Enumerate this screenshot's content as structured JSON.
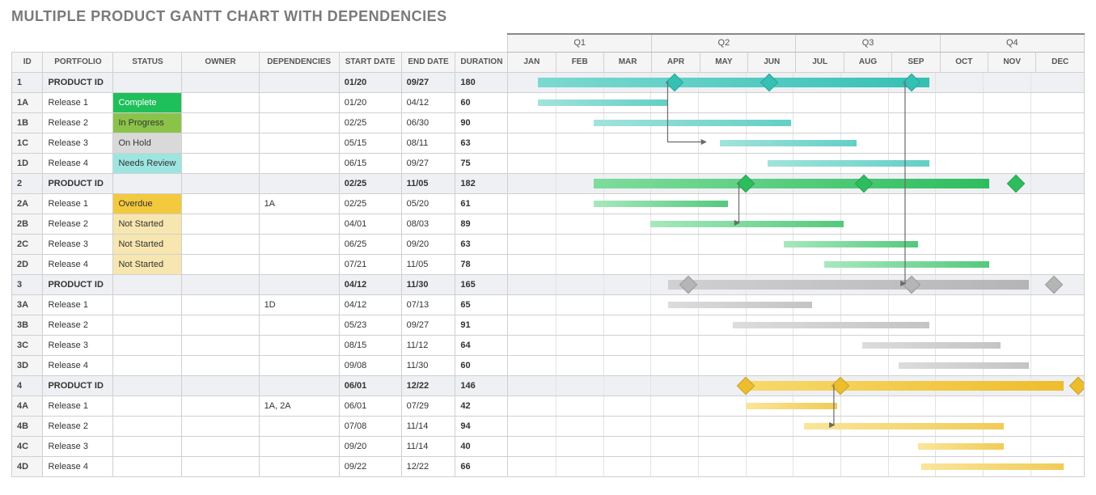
{
  "title": "MULTIPLE PRODUCT GANTT CHART WITH DEPENDENCIES",
  "headers": {
    "id": "ID",
    "portfolio": "PORTFOLIO",
    "status": "STATUS",
    "owner": "OWNER",
    "deps": "DEPENDENCIES",
    "start": "START DATE",
    "end": "END DATE",
    "dur": "DURATION"
  },
  "quarters": [
    "Q1",
    "Q2",
    "Q3",
    "Q4"
  ],
  "months": [
    "JAN",
    "FEB",
    "MAR",
    "APR",
    "MAY",
    "JUN",
    "JUL",
    "AUG",
    "SEP",
    "OCT",
    "NOV",
    "DEC"
  ],
  "status_labels": {
    "complete": "Complete",
    "progress": "In Progress",
    "hold": "On Hold",
    "review": "Needs Review",
    "overdue": "Overdue",
    "notstarted": "Not Started"
  },
  "rows": [
    {
      "id": "1",
      "portfolio": "PRODUCT ID",
      "status": "",
      "owner": "",
      "deps": "",
      "start": "01/20",
      "end": "09/27",
      "dur": "180",
      "product": true,
      "color": "teal",
      "barClass": "teal",
      "lbarClass": "tealL",
      "milestones": [
        3.5,
        5.5,
        8.5
      ]
    },
    {
      "id": "1A",
      "portfolio": "Release 1",
      "status": "complete",
      "owner": "",
      "deps": "",
      "start": "01/20",
      "end": "04/12",
      "dur": "60",
      "color": "teal"
    },
    {
      "id": "1B",
      "portfolio": "Release 2",
      "status": "progress",
      "owner": "",
      "deps": "",
      "start": "02/25",
      "end": "06/30",
      "dur": "90",
      "color": "teal"
    },
    {
      "id": "1C",
      "portfolio": "Release 3",
      "status": "hold",
      "owner": "",
      "deps": "",
      "start": "05/15",
      "end": "08/11",
      "dur": "63",
      "color": "teal"
    },
    {
      "id": "1D",
      "portfolio": "Release 4",
      "status": "review",
      "owner": "",
      "deps": "",
      "start": "06/15",
      "end": "09/27",
      "dur": "75",
      "color": "teal"
    },
    {
      "id": "2",
      "portfolio": "PRODUCT ID",
      "status": "",
      "owner": "",
      "deps": "",
      "start": "02/25",
      "end": "11/05",
      "dur": "182",
      "product": true,
      "color": "green",
      "barClass": "green",
      "lbarClass": "greenL",
      "milestones": [
        5.0,
        7.5,
        10.7
      ]
    },
    {
      "id": "2A",
      "portfolio": "Release 1",
      "status": "overdue",
      "owner": "",
      "deps": "1A",
      "start": "02/25",
      "end": "05/20",
      "dur": "61",
      "color": "green"
    },
    {
      "id": "2B",
      "portfolio": "Release 2",
      "status": "notstarted",
      "owner": "",
      "deps": "",
      "start": "04/01",
      "end": "08/03",
      "dur": "89",
      "color": "green"
    },
    {
      "id": "2C",
      "portfolio": "Release 3",
      "status": "notstarted",
      "owner": "",
      "deps": "",
      "start": "06/25",
      "end": "09/20",
      "dur": "63",
      "color": "green"
    },
    {
      "id": "2D",
      "portfolio": "Release 4",
      "status": "notstarted",
      "owner": "",
      "deps": "",
      "start": "07/21",
      "end": "11/05",
      "dur": "78",
      "color": "green"
    },
    {
      "id": "3",
      "portfolio": "PRODUCT ID",
      "status": "",
      "owner": "",
      "deps": "",
      "start": "04/12",
      "end": "11/30",
      "dur": "165",
      "product": true,
      "color": "gray",
      "barClass": "grayB",
      "lbarClass": "grayL",
      "milestones": [
        3.8,
        8.5,
        11.5
      ]
    },
    {
      "id": "3A",
      "portfolio": "Release 1",
      "status": "",
      "owner": "",
      "deps": "1D",
      "start": "04/12",
      "end": "07/13",
      "dur": "65",
      "color": "gray"
    },
    {
      "id": "3B",
      "portfolio": "Release 2",
      "status": "",
      "owner": "",
      "deps": "",
      "start": "05/23",
      "end": "09/27",
      "dur": "91",
      "color": "gray"
    },
    {
      "id": "3C",
      "portfolio": "Release 3",
      "status": "",
      "owner": "",
      "deps": "",
      "start": "08/15",
      "end": "11/12",
      "dur": "64",
      "color": "gray"
    },
    {
      "id": "3D",
      "portfolio": "Release 4",
      "status": "",
      "owner": "",
      "deps": "",
      "start": "09/08",
      "end": "11/30",
      "dur": "60",
      "color": "gray"
    },
    {
      "id": "4",
      "portfolio": "PRODUCT ID",
      "status": "",
      "owner": "",
      "deps": "",
      "start": "06/01",
      "end": "12/22",
      "dur": "146",
      "product": true,
      "color": "gold",
      "barClass": "gold",
      "lbarClass": "goldL",
      "milestones": [
        5.0,
        7.0,
        12.0
      ]
    },
    {
      "id": "4A",
      "portfolio": "Release 1",
      "status": "",
      "owner": "",
      "deps": "1A, 2A",
      "start": "06/01",
      "end": "07/29",
      "dur": "42",
      "color": "gold"
    },
    {
      "id": "4B",
      "portfolio": "Release 2",
      "status": "",
      "owner": "",
      "deps": "",
      "start": "07/08",
      "end": "11/14",
      "dur": "94",
      "color": "gold"
    },
    {
      "id": "4C",
      "portfolio": "Release 3",
      "status": "",
      "owner": "",
      "deps": "",
      "start": "09/20",
      "end": "11/14",
      "dur": "40",
      "color": "gold"
    },
    {
      "id": "4D",
      "portfolio": "Release 4",
      "status": "",
      "owner": "",
      "deps": "",
      "start": "09/22",
      "end": "12/22",
      "dur": "66",
      "color": "gold"
    }
  ],
  "dependencies": [
    {
      "from": "1A",
      "to": "2A"
    },
    {
      "from": "1D",
      "to": "3A"
    },
    {
      "from": "1A",
      "to": "4A"
    },
    {
      "from": "2A",
      "to": "4A"
    }
  ],
  "chart_data": {
    "type": "gantt",
    "title": "Multiple Product Gantt Chart with Dependencies",
    "x_axis": {
      "unit": "month",
      "range": [
        "JAN",
        "DEC"
      ],
      "quarters": [
        "Q1",
        "Q2",
        "Q3",
        "Q4"
      ]
    },
    "tasks": [
      {
        "id": "1",
        "name": "PRODUCT ID",
        "start": "01/20",
        "end": "09/27",
        "duration": 180,
        "group": true,
        "milestones": [
          "APR-mid",
          "JUN-mid",
          "SEP-mid"
        ]
      },
      {
        "id": "1A",
        "name": "Release 1",
        "start": "01/20",
        "end": "04/12",
        "duration": 60,
        "status": "Complete"
      },
      {
        "id": "1B",
        "name": "Release 2",
        "start": "02/25",
        "end": "06/30",
        "duration": 90,
        "status": "In Progress"
      },
      {
        "id": "1C",
        "name": "Release 3",
        "start": "05/15",
        "end": "08/11",
        "duration": 63,
        "status": "On Hold"
      },
      {
        "id": "1D",
        "name": "Release 4",
        "start": "06/15",
        "end": "09/27",
        "duration": 75,
        "status": "Needs Review"
      },
      {
        "id": "2",
        "name": "PRODUCT ID",
        "start": "02/25",
        "end": "11/05",
        "duration": 182,
        "group": true,
        "milestones": [
          "MAY-end",
          "AUG-mid",
          "NOV-early"
        ]
      },
      {
        "id": "2A",
        "name": "Release 1",
        "start": "02/25",
        "end": "05/20",
        "duration": 61,
        "status": "Overdue",
        "depends_on": [
          "1A"
        ]
      },
      {
        "id": "2B",
        "name": "Release 2",
        "start": "04/01",
        "end": "08/03",
        "duration": 89,
        "status": "Not Started"
      },
      {
        "id": "2C",
        "name": "Release 3",
        "start": "06/25",
        "end": "09/20",
        "duration": 63,
        "status": "Not Started"
      },
      {
        "id": "2D",
        "name": "Release 4",
        "start": "07/21",
        "end": "11/05",
        "duration": 78,
        "status": "Not Started"
      },
      {
        "id": "3",
        "name": "PRODUCT ID",
        "start": "04/12",
        "end": "11/30",
        "duration": 165,
        "group": true,
        "milestones": [
          "APR-mid",
          "SEP-mid",
          "DEC-early"
        ]
      },
      {
        "id": "3A",
        "name": "Release 1",
        "start": "04/12",
        "end": "07/13",
        "duration": 65,
        "depends_on": [
          "1D"
        ]
      },
      {
        "id": "3B",
        "name": "Release 2",
        "start": "05/23",
        "end": "09/27",
        "duration": 91
      },
      {
        "id": "3C",
        "name": "Release 3",
        "start": "08/15",
        "end": "11/12",
        "duration": 64
      },
      {
        "id": "3D",
        "name": "Release 4",
        "start": "09/08",
        "end": "11/30",
        "duration": 60
      },
      {
        "id": "4",
        "name": "PRODUCT ID",
        "start": "06/01",
        "end": "12/22",
        "duration": 146,
        "group": true,
        "milestones": [
          "JUN-early",
          "AUG-early",
          "DEC-end"
        ]
      },
      {
        "id": "4A",
        "name": "Release 1",
        "start": "06/01",
        "end": "07/29",
        "duration": 42,
        "depends_on": [
          "1A",
          "2A"
        ]
      },
      {
        "id": "4B",
        "name": "Release 2",
        "start": "07/08",
        "end": "11/14",
        "duration": 94
      },
      {
        "id": "4C",
        "name": "Release 3",
        "start": "09/20",
        "end": "11/14",
        "duration": 40
      },
      {
        "id": "4D",
        "name": "Release 4",
        "start": "09/22",
        "end": "12/22",
        "duration": 66
      }
    ],
    "dependencies": [
      [
        "1A",
        "2A"
      ],
      [
        "1D",
        "3A"
      ],
      [
        "1A",
        "4A"
      ],
      [
        "2A",
        "4A"
      ]
    ]
  }
}
